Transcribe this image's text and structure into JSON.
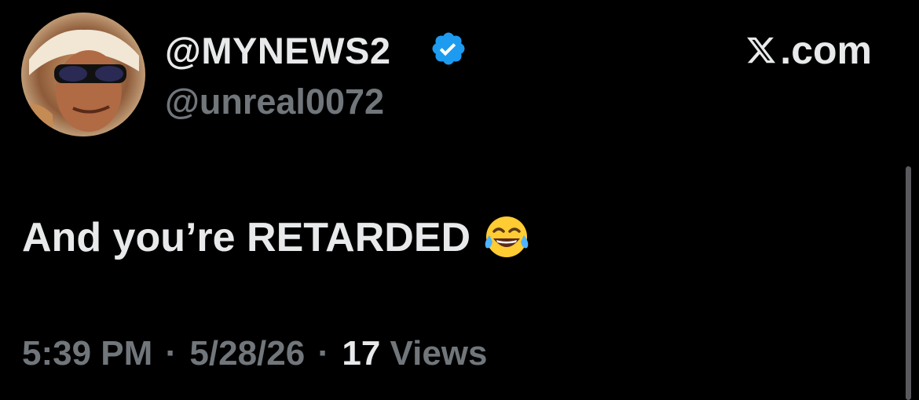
{
  "tweet": {
    "display_name": "@MYNEWS2",
    "handle": "@unreal0072",
    "verified_icon": "verified-badge-icon",
    "source_label": ".com",
    "source_logo_icon": "x-logo-icon",
    "text": "And you’re RETARDED",
    "emoji_icon": "face-with-tears-of-joy-emoji",
    "time": "5:39 PM",
    "date": "5/28/26",
    "separator": "·",
    "views_count": "17",
    "views_label": "Views"
  },
  "colors": {
    "background": "#000000",
    "primary_text": "#e7e9ea",
    "secondary_text": "#71767b",
    "verified_blue": "#1d9bf0"
  }
}
